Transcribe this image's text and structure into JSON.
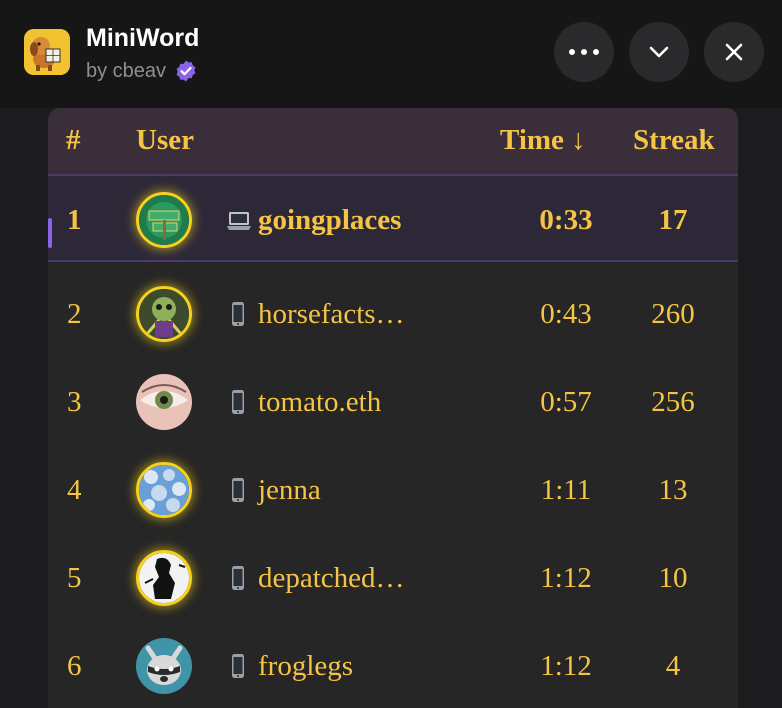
{
  "app": {
    "name": "MiniWord",
    "byline": "by cbeav"
  },
  "header": {
    "buttons": [
      "more",
      "collapse",
      "close"
    ]
  },
  "table": {
    "columns": {
      "rank": "#",
      "user": "User",
      "time": "Time ↓",
      "streak": "Streak"
    },
    "rows": [
      {
        "rank": "1",
        "user": "goingplaces",
        "time": "0:33",
        "streak": "17",
        "device": "laptop-icon",
        "highlighted": true
      },
      {
        "rank": "2",
        "user": "horsefacts…",
        "time": "0:43",
        "streak": "260",
        "device": "phone-icon"
      },
      {
        "rank": "3",
        "user": "tomato.eth",
        "time": "0:57",
        "streak": "256",
        "device": "phone-icon"
      },
      {
        "rank": "4",
        "user": "jenna",
        "time": "1:11",
        "streak": "13",
        "device": "phone-icon"
      },
      {
        "rank": "5",
        "user": "depatched…",
        "time": "1:12",
        "streak": "10",
        "device": "phone-icon"
      },
      {
        "rank": "6",
        "user": "froglegs",
        "time": "1:12",
        "streak": "4",
        "device": "phone-icon"
      }
    ]
  },
  "colors": {
    "accent_text": "#f6c445",
    "highlight_bar": "#8a63e8",
    "verified_badge": "#8a63e8"
  }
}
